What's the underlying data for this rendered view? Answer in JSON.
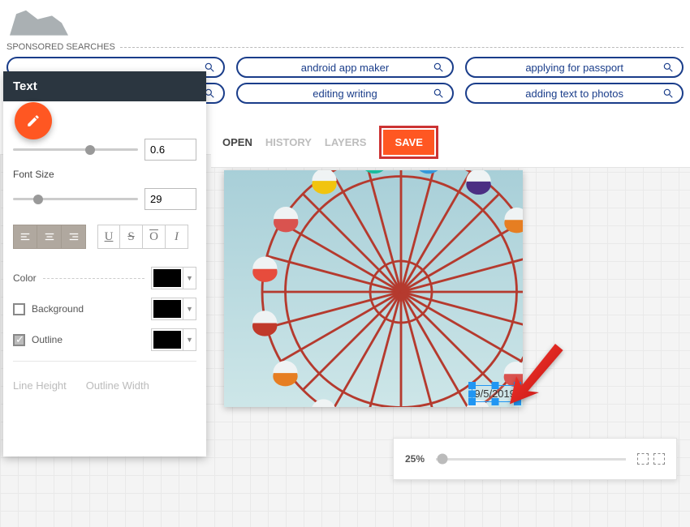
{
  "header": {
    "sponsored_label": "SPONSORED SEARCHES"
  },
  "search_pills": [
    [
      "",
      "android app maker",
      "applying for passport"
    ],
    [
      "",
      "editing writing",
      "adding text to photos"
    ]
  ],
  "tabs": {
    "open": "OPEN",
    "history": "HISTORY",
    "layers": "LAYERS",
    "save": "SAVE"
  },
  "panel": {
    "title": "Text",
    "thickness_value": "0.6",
    "font_size_label": "Font Size",
    "font_size_value": "29",
    "color_label": "Color",
    "background_label": "Background",
    "outline_label": "Outline",
    "line_height_label": "Line Height",
    "outline_width_label": "Outline Width",
    "background_checked": false,
    "outline_checked": true,
    "colors": {
      "text": "#000000",
      "background": "#000000",
      "outline": "#000000"
    }
  },
  "canvas": {
    "text_overlay": "9/5/2019",
    "zoom_label": "25%"
  },
  "wheel_colors": [
    "#e74c3c",
    "#d9534f",
    "#f1c40f",
    "#1abc9c",
    "#3498db",
    "#4b2e83",
    "#e67e22",
    "#c0392b"
  ]
}
